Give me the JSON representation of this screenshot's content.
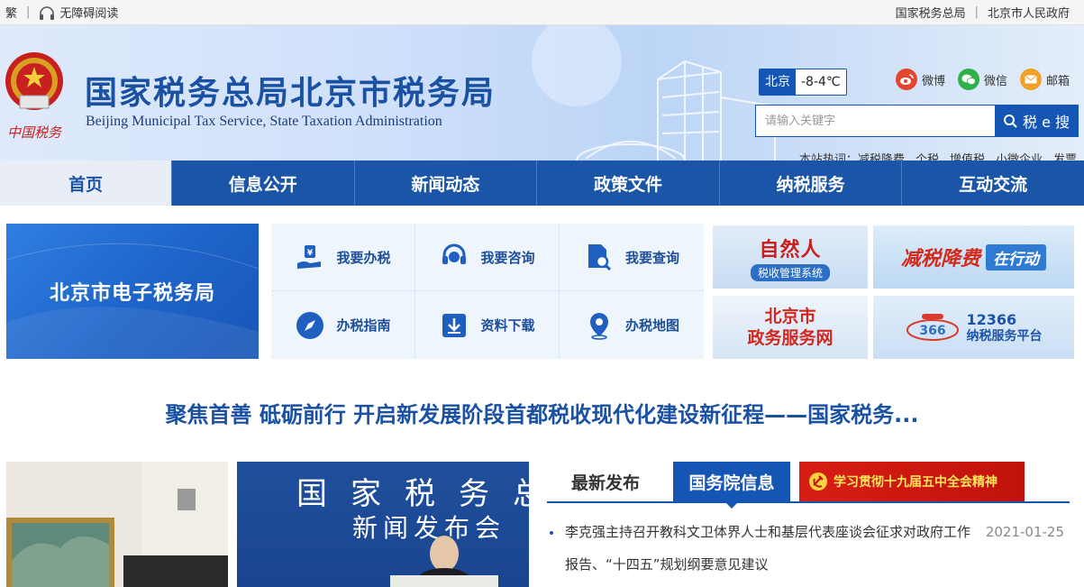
{
  "topbar": {
    "traditional": "繁",
    "accessible": "无障碍阅读",
    "link_sat": "国家税务总局",
    "link_gov": "北京市人民政府"
  },
  "header": {
    "title": "国家税务总局北京市税务局",
    "subtitle": "Beijing Municipal Tax Service, State Taxation Administration",
    "emblem_text": "中国税务",
    "weather": {
      "city": "北京",
      "temp": "-8-4℃"
    },
    "social": {
      "weibo": "微博",
      "wechat": "微信",
      "mail": "邮箱"
    },
    "search": {
      "placeholder": "请输入关键字",
      "button": "税 e 搜"
    },
    "hot": {
      "label": "本站热词：",
      "words": [
        "减税降费",
        "个税",
        "增值税",
        "小微企业",
        "发票"
      ]
    }
  },
  "nav": [
    "首页",
    "信息公开",
    "新闻动态",
    "政策文件",
    "纳税服务",
    "互动交流"
  ],
  "services": {
    "etax": "北京市电子税务局",
    "grid": [
      "我要办税",
      "我要咨询",
      "我要查询",
      "办税指南",
      "资料下载",
      "办税地图"
    ],
    "banners": {
      "b1_t1": "自然人",
      "b1_t2": "税收管理系统",
      "b2_t1": "减税降费",
      "b2_t2": "在行动",
      "b3_t1": "北京市",
      "b3_t2": "政务服务网",
      "b4_t1": "12366",
      "b4_t2": "纳税服务平台"
    }
  },
  "headline": "聚焦首善 砥砺前行 开启新发展阶段首都税收现代化建设新征程——国家税务...",
  "photo2": {
    "line1": "国家税务总",
    "line2": "新闻发布会"
  },
  "news": {
    "tab_latest": "最新发布",
    "tab_council": "国务院信息",
    "study": "学习贯彻十九届五中全会精神",
    "items": [
      {
        "title": "李克强主持召开教科文卫体界人士和基层代表座谈会征求对政府工作报告、“十四五”规划纲要意见建议",
        "date": "2021-01-25"
      }
    ]
  },
  "colors": {
    "primary": "#1556b4",
    "nav": "#1a55a8",
    "title": "#1b51a3",
    "red": "#c8201e"
  }
}
